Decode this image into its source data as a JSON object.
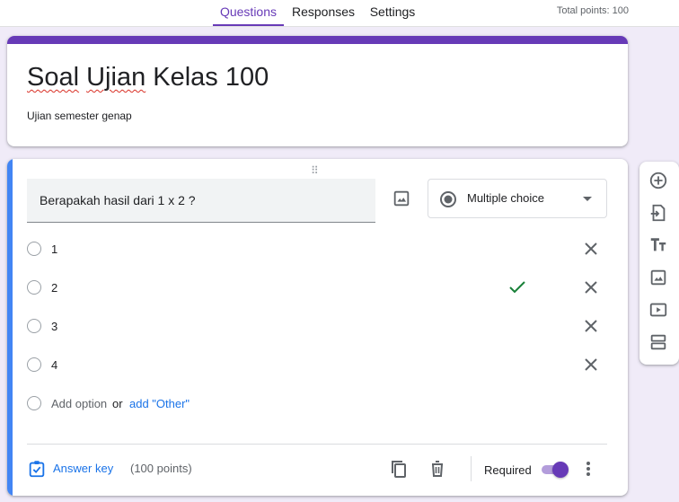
{
  "tabs": {
    "questions": "Questions",
    "responses": "Responses",
    "settings": "Settings"
  },
  "total_points": "Total points: 100",
  "form": {
    "title_word1": "Soal",
    "title_word2": "Ujian",
    "title_rest": "Kelas 100",
    "description": "Ujian semester genap"
  },
  "question": {
    "text": "Berapakah hasil dari 1 x 2 ?",
    "type": "Multiple choice",
    "options": [
      "1",
      "2",
      "3",
      "4"
    ],
    "correct_option_index": 1,
    "add_option": "Add option",
    "or": "or",
    "add_other": "add \"Other\""
  },
  "footer": {
    "answer_key": "Answer key",
    "points": "(100 points)",
    "required": "Required",
    "required_on": true
  },
  "colors": {
    "accent": "#673ab7",
    "focus_bar": "#4285f4",
    "link": "#1a73e8",
    "check": "#188038"
  }
}
